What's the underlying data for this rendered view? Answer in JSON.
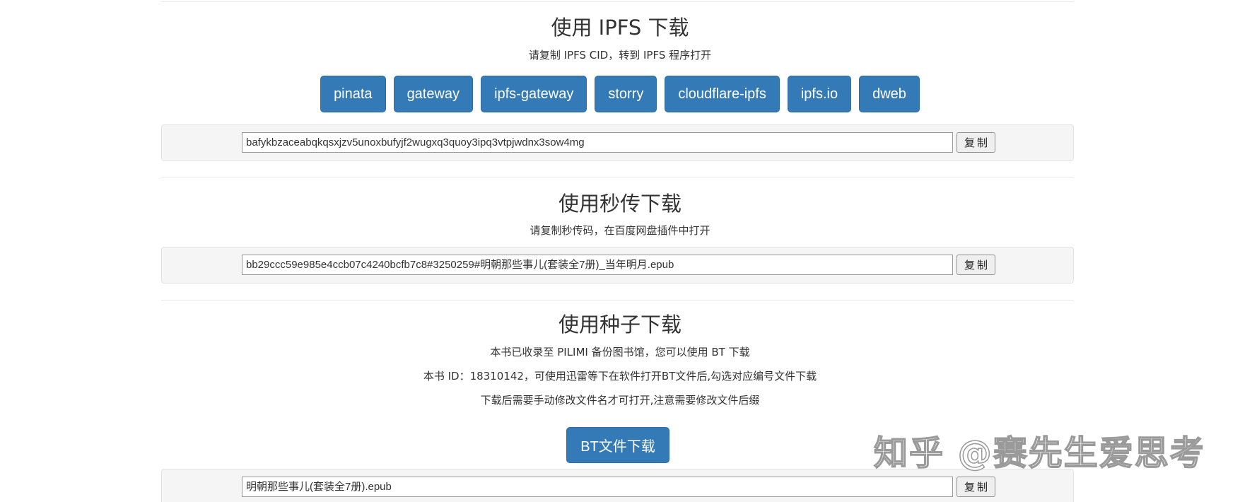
{
  "ipfs": {
    "title": "使用 IPFS 下载",
    "subtitle": "请复制 IPFS CID，转到 IPFS 程序打开",
    "gateways": [
      "pinata",
      "gateway",
      "ipfs-gateway",
      "storry",
      "cloudflare-ipfs",
      "ipfs.io",
      "dweb"
    ],
    "cid": "bafykbzaceabqkqsxjzv5unoxbufyjf2wugxq3quoy3ipq3vtpjwdnx3sow4mg",
    "copy_label": "复制"
  },
  "instant": {
    "title": "使用秒传下载",
    "subtitle": "请复制秒传码，在百度网盘插件中打开",
    "code": "bb29ccc59e985e4ccb07c4240bcfb7c8#3250259#明朝那些事儿(套装全7册)_当年明月.epub",
    "copy_label": "复制"
  },
  "torrent": {
    "title": "使用种子下载",
    "line1": "本书已收录至 PILIMI 备份图书馆，您可以使用 BT 下载",
    "line2": "本书 ID：18310142，可使用迅雷等下在软件打开BT文件后,勾选对应编号文件下载",
    "line3": "下载后需要手动修改文件名才可打开,注意需要修改文件后缀",
    "bt_button": "BT文件下载",
    "filename": "明朝那些事儿(套装全7册).epub",
    "copy_label": "复制"
  },
  "watermark": "知乎 @赛先生爱思考",
  "colors": {
    "primary": "#337ab7",
    "well_bg": "#f5f5f5"
  }
}
